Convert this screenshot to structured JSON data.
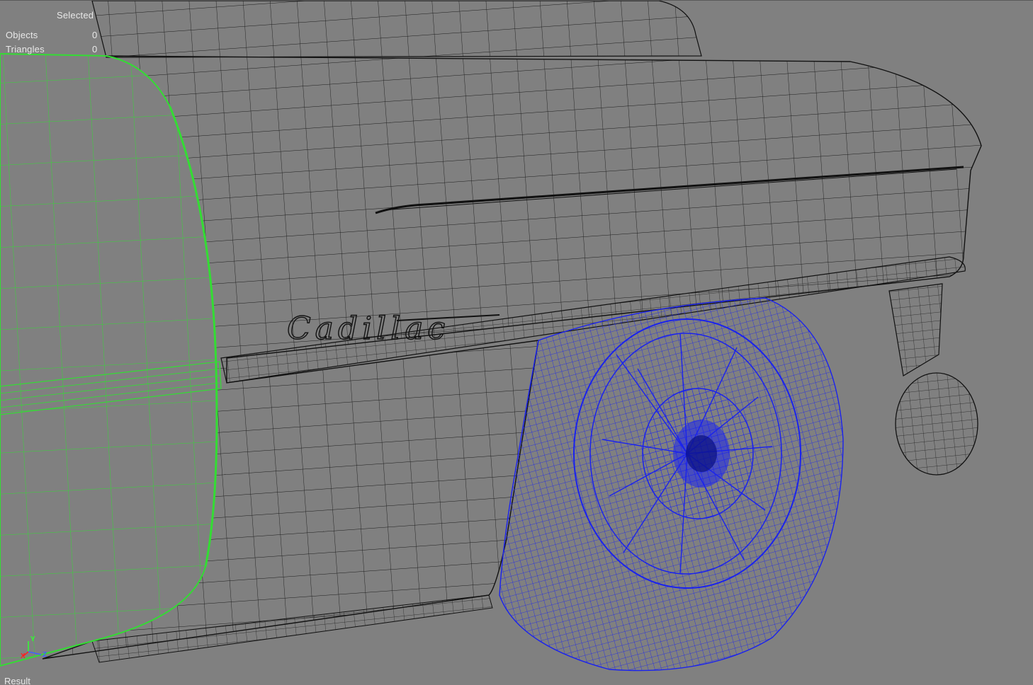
{
  "viewport": {
    "name": "3D perspective viewport",
    "background": "#808080"
  },
  "stats": {
    "header": "Selected",
    "rows": [
      {
        "label": "Objects",
        "value": "0"
      },
      {
        "label": "Triangles",
        "value": "0"
      }
    ]
  },
  "status": {
    "label": "Result"
  },
  "axis_gizmo": {
    "x": "X",
    "y": "Y",
    "z": "Z",
    "x_color": "#ff2020",
    "y_color": "#30ff30",
    "z_color": "#4060ff"
  },
  "wire_colors": {
    "body": "#111111",
    "selected_door": "#33dd33",
    "wheel": "#1a22ee"
  },
  "emblem_text": "Cadillac"
}
